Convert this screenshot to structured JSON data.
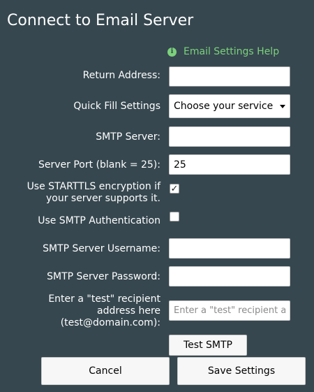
{
  "dialog": {
    "title": "Connect to Email Server",
    "help_link": "Email Settings Help",
    "help_icon": "info-icon"
  },
  "form": {
    "return_address": {
      "label": "Return Address:",
      "value": ""
    },
    "quick_fill": {
      "label": "Quick Fill Settings",
      "selected": "Choose your service"
    },
    "smtp_server": {
      "label": "SMTP Server:",
      "value": ""
    },
    "server_port": {
      "label": "Server Port (blank = 25):",
      "value": "25"
    },
    "starttls": {
      "label_line1": "Use STARTTLS encryption if",
      "label_line2": "your server supports it.",
      "checked": true
    },
    "smtp_auth": {
      "label": "Use SMTP Authentication",
      "checked": false
    },
    "username": {
      "label": "SMTP Server Username:",
      "value": ""
    },
    "password": {
      "label": "SMTP Server Password:",
      "value": ""
    },
    "test_recipient": {
      "label_line1": "Enter a \"test\" recipient",
      "label_line2": "address here",
      "label_line3": "(test@domain.com):",
      "placeholder": "Enter a \"test\" recipient address",
      "value": ""
    }
  },
  "buttons": {
    "test_smtp": "Test SMTP",
    "cancel": "Cancel",
    "save": "Save Settings"
  },
  "colors": {
    "background": "#36474f",
    "help_link": "#7cd17c"
  }
}
